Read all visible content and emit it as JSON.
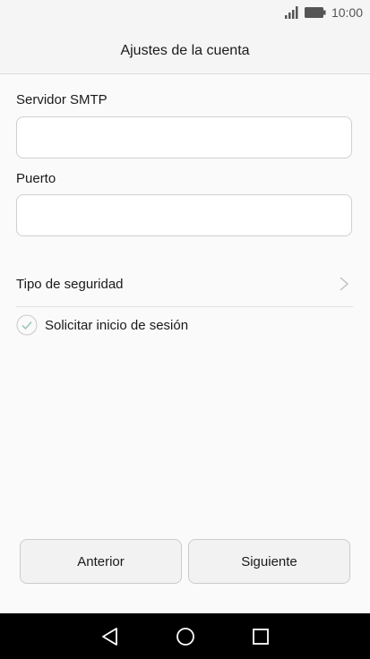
{
  "status_bar": {
    "time": "10:00",
    "icons": [
      "signal-icon",
      "battery-icon"
    ]
  },
  "header": {
    "title": "Ajustes de la cuenta"
  },
  "form": {
    "smtp_label": "Servidor SMTP",
    "smtp_value": "",
    "port_label": "Puerto",
    "port_value": "",
    "security_label": "Tipo de seguridad",
    "login_label": "Solicitar inicio de sesión",
    "login_checked": true
  },
  "buttons": {
    "previous": "Anterior",
    "next": "Siguiente"
  },
  "nav_bar": {
    "icons": [
      "back-icon",
      "home-icon",
      "recents-icon"
    ]
  },
  "colors": {
    "background": "#fafafa",
    "text": "#1a1a1a",
    "input_border": "#cfcfcf",
    "check": "#9bc7b8",
    "nav_bar": "#000000"
  }
}
